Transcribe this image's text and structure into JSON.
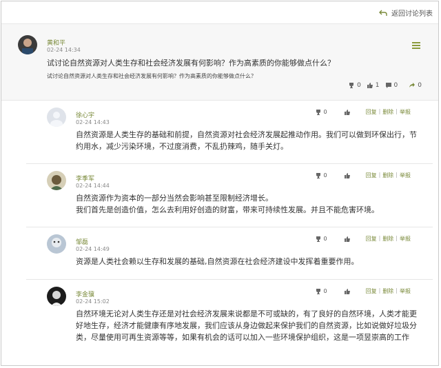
{
  "topbar": {
    "back_label": "返回讨论列表"
  },
  "post": {
    "author": "黄和平",
    "time": "02-24 14:34",
    "title": "试讨论自然资源对人类生存和社会经济发展有何影响？作为高素质的你能够做点什么？",
    "subtitle": "试讨论自然资源对人类生存和社会经济发展有何影响？作为高素质的你能够做点什么？",
    "likes": "0",
    "thumbs": "1",
    "comments": "0",
    "shares": "0"
  },
  "replies": [
    {
      "author": "徐心宇",
      "time": "02-24 14:43",
      "text": "自然资源是人类生存的基础和前提，自然资源对社会经济发展起推动作用。我们可以做到环保出行，节约用水，减少污染环境，不过度消费，不乱扔辣鸡，随手关灯。",
      "likes": "0",
      "reply_label": "回复",
      "delete_label": "删除",
      "report_label": "举报"
    },
    {
      "author": "李季军",
      "time": "02-24 14:44",
      "text": "自然资源作为资本的一部分当然会影响甚至限制经济增长。\n我们首先是创造价值，怎么去利用好创造的财富，带来可持续性发展。并且不能危害环境。",
      "likes": "0",
      "reply_label": "回复",
      "delete_label": "删除",
      "report_label": "举报"
    },
    {
      "author": "邹磊",
      "time": "02-24 14:49",
      "text": "资源是人类社会赖以生存和发展的基础,自然资源在社会经济建设中发挥着重要作用。",
      "likes": "0",
      "reply_label": "回复",
      "delete_label": "删除",
      "report_label": "举报"
    },
    {
      "author": "李金骥",
      "time": "02-24 15:02",
      "text": "自然环境无论对人类生存还是对社会经济发展来说都是不可或缺的，有了良好的自然环境，人类才能更好地生存，经济才能健康有序地发展，我们应该从身边做起来保护我们的自然资源，比如说做好垃圾分类，尽量使用可再生资源等等，如果有机会的话可以加入一些环境保护组织，这是一项昱崇高的工作",
      "likes": "0",
      "reply_label": "回复",
      "delete_label": "删除",
      "report_label": "举报"
    }
  ]
}
